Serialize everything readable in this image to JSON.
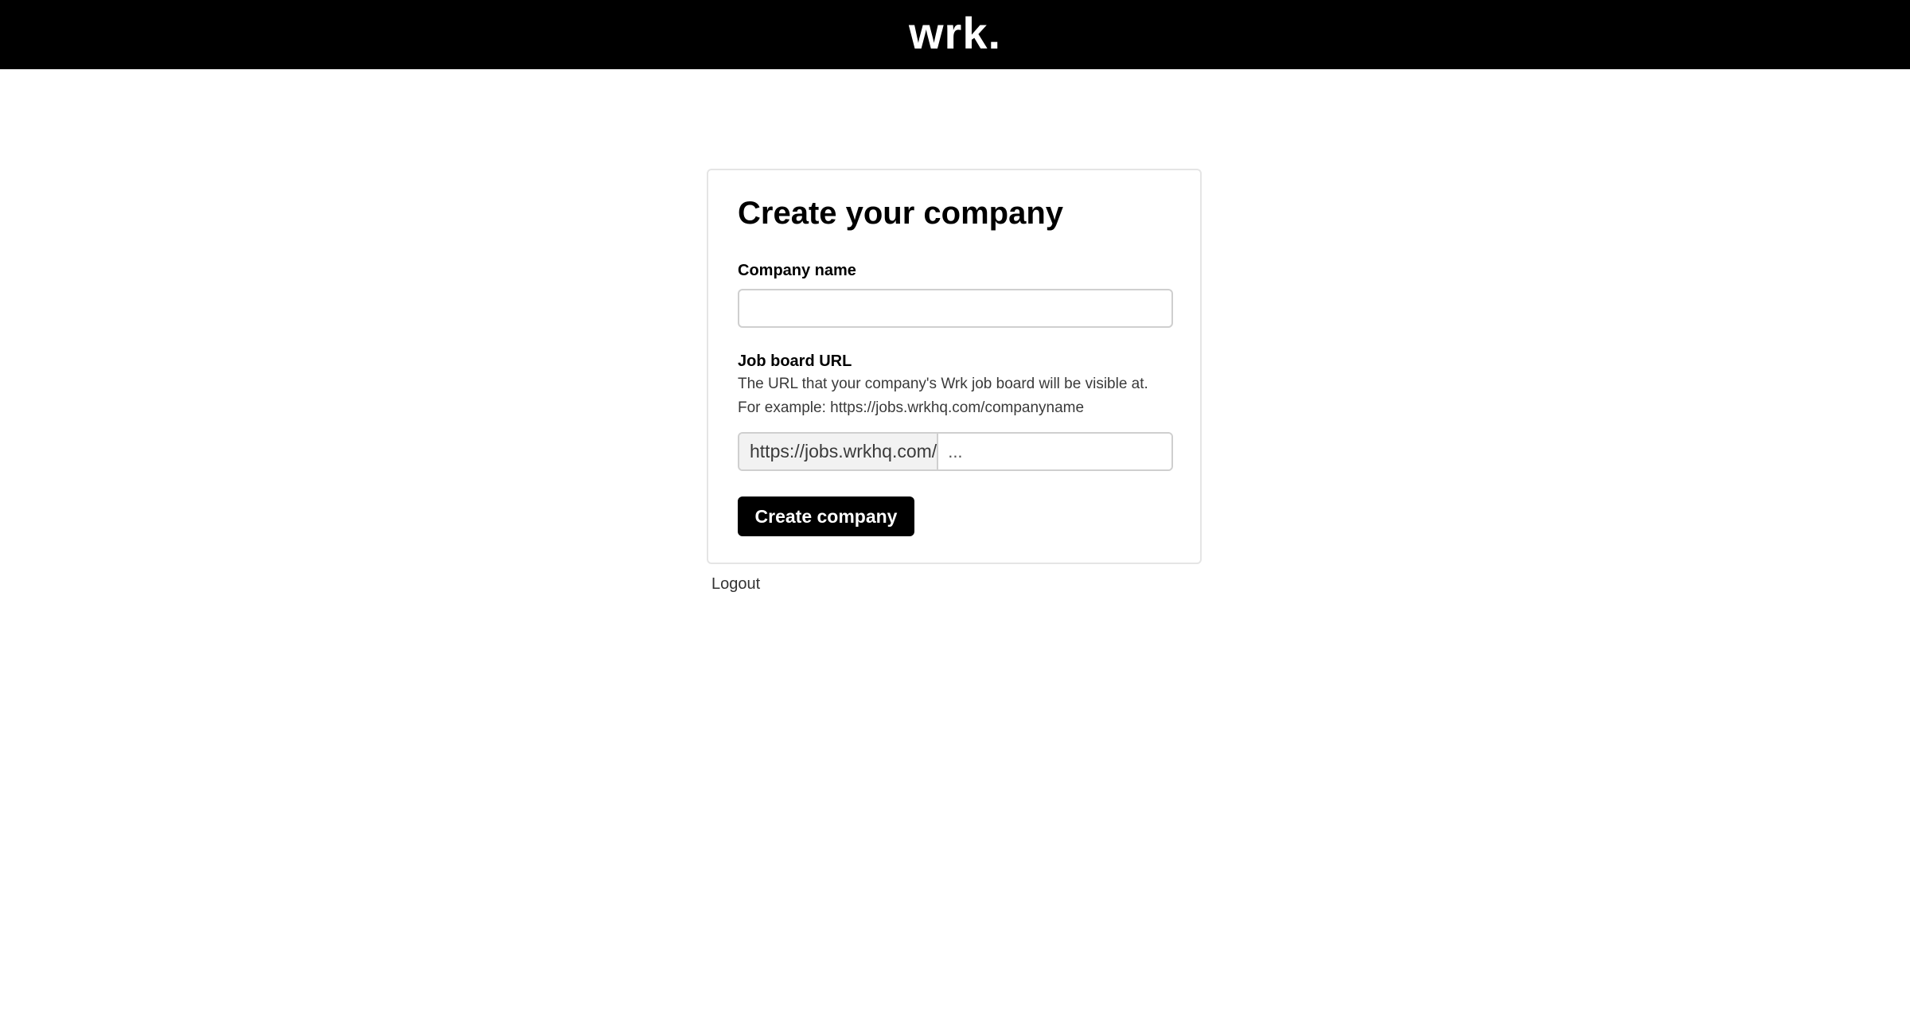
{
  "header": {
    "logo_text": "wrk."
  },
  "form": {
    "title": "Create your company",
    "company_name": {
      "label": "Company name",
      "value": "",
      "placeholder": ""
    },
    "job_board_url": {
      "label": "Job board URL",
      "help_line_1": "The URL that your company's Wrk job board will be visible at.",
      "help_line_2": "For example: https://jobs.wrkhq.com/companyname",
      "prefix": "https://jobs.wrkhq.com/",
      "value": "",
      "placeholder": "..."
    },
    "submit_label": "Create company"
  },
  "footer": {
    "logout_label": "Logout"
  },
  "colors": {
    "header_background": "#000000",
    "button_background": "#000000",
    "card_border": "#e5e5e5",
    "input_border": "#cfcfcf",
    "prefix_background": "#f2f2f2"
  }
}
